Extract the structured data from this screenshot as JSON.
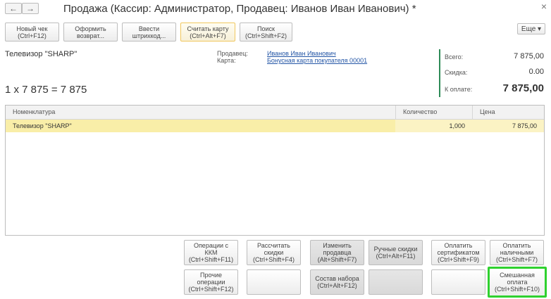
{
  "window": {
    "title": "Продажа (Кассир: Администратор, Продавец: Иванов Иван Иванович) *",
    "back": "←",
    "forward": "→",
    "close": "×"
  },
  "toolbar": {
    "buttons": [
      {
        "label": "Новый чек\n(Ctrl+F12)"
      },
      {
        "label": "Оформить\nвозврат..."
      },
      {
        "label": "Ввести\nштрихкод..."
      },
      {
        "label": "Считать карту\n(Ctrl+Alt+F7)"
      },
      {
        "label": "Поиск\n(Ctrl+Shift+F2)"
      }
    ],
    "more": "Еще ▾"
  },
  "info": {
    "item_name": "Телевизор \"SHARP\"",
    "calculation": "1 x 7 875 = 7 875",
    "seller_label": "Продавец:",
    "seller_value": "Иванов Иван Иванович",
    "card_label": "Карта:",
    "card_value": "Бонусная карта покупателя 00001"
  },
  "totals": {
    "total_label": "Всего:",
    "total_value": "7 875,00",
    "discount_label": "Скидка:",
    "discount_value": "0.00",
    "to_pay_label": "К оплате:",
    "to_pay_value": "7 875,00"
  },
  "table": {
    "headers": [
      "Номенклатура",
      "Количество",
      "Цена"
    ],
    "rows": [
      {
        "name": "Телевизор \"SHARP\"",
        "qty": "1,000",
        "price": "7 875,00"
      }
    ]
  },
  "actions": {
    "row1": [
      {
        "label": "Операции с\nККМ\n(Ctrl+Shift+F11)"
      },
      {
        "label": "Рассчитать\nскидки\n(Ctrl+Shift+F4)"
      },
      {
        "label": "Изменить\nпродавца\n(Alt+Shift+F7)"
      },
      {
        "label": "Ручные скидки\n(Ctrl+Alt+F11)"
      },
      {
        "label": "Оплатить\nсертификатом\n(Ctrl+Shift+F9)"
      },
      {
        "label": "Оплатить\nналичными\n(Ctrl+Shift+F7)"
      }
    ],
    "row2": [
      {
        "label": "Прочие\nоперации\n(Ctrl+Shift+F12)"
      },
      {
        "label": ""
      },
      {
        "label": "Состав набора\n(Ctrl+Alt+F12)"
      },
      {
        "label": ""
      },
      {
        "label": ""
      },
      {
        "label": "Смешанная\nоплата\n(Ctrl+Shift+F10)"
      }
    ]
  },
  "colors": {
    "highlight_row": "#f9eea8",
    "totals_bar": "#2e8b57",
    "selected_border": "#2fd12f",
    "link": "#2456a6"
  }
}
